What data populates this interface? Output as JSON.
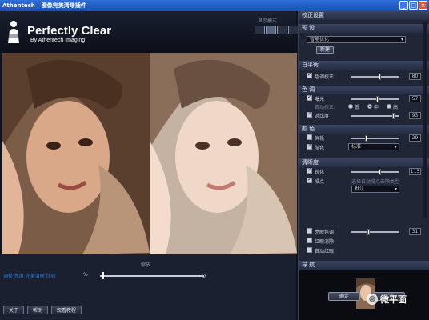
{
  "window": {
    "app_name": "Athentech",
    "title": "图像完美清晰插件",
    "min": "_",
    "max": "□",
    "close": "×"
  },
  "header": {
    "logo_title": "Perfectly Clear",
    "logo_sub": "By Athentech Imaging",
    "view_label": "显示模式"
  },
  "bottom": {
    "zoom_label": "缩放",
    "status": "调整 亮度 完美清晰 比较",
    "zoom_unit": "%",
    "buttons": {
      "about": "关于",
      "help": "帮助",
      "tutorial": "观看教程"
    }
  },
  "panel": {
    "title": "校正设置",
    "presets": {
      "title": "预 设",
      "selected": "智能优化",
      "new_label": "新建"
    },
    "white_balance": {
      "title": "白平衡",
      "tint_label": "色调校正",
      "tint_value": "80",
      "tint_level": 0.6
    },
    "tone": {
      "title": "色 调",
      "exposure_label": "曝光",
      "exposure_value": "57",
      "exposure_level": 0.55,
      "auto_label": "自动校正:",
      "radio_low": "低",
      "radio_mid": "中",
      "radio_high": "高",
      "contrast_label": "对比度",
      "contrast_value": "93",
      "contrast_level": 0.9
    },
    "color": {
      "title": "颜 色",
      "vibrancy_label": "鲜艳",
      "vibrancy_value": "29",
      "vibrancy_level": 0.3,
      "skin_label": "肤色",
      "skin_selected": "标准"
    },
    "clarity": {
      "title": "清晰度",
      "sharpen_label": "锐化",
      "sharpen_value": "115",
      "sharpen_level": 0.6,
      "noise_label": "噪点",
      "noise_hint": "选择自动噪点去除类型",
      "noise_selected": "默认"
    },
    "extras": {
      "eye_label": "亮眼色调",
      "eye_value": "31",
      "eye_level": 0.35,
      "redeye_label": "红眼消除",
      "auto_label": "自动红眼"
    },
    "nav": {
      "title": "导 航"
    },
    "ok": "确定",
    "cancel": "取消"
  },
  "watermark": "微平面",
  "colors": {
    "titlebar": "#1a4fb8",
    "panel": "#202636",
    "accent": "#2f7bd8"
  }
}
